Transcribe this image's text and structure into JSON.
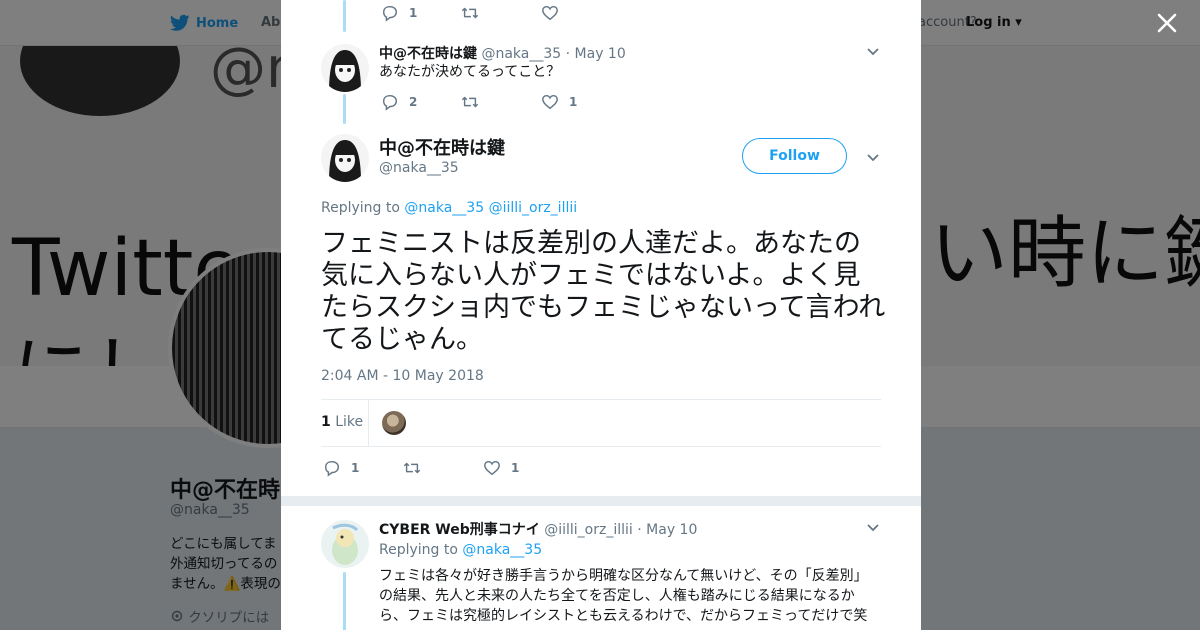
{
  "background": {
    "nav_home": "Home",
    "nav_about": "Abo",
    "account_prompt": "account?",
    "login": "Log in",
    "banner_text_left": "Twitterに",
    "banner_text_right": "い時に鍵",
    "banner_text_bottom": "にし",
    "banner_handle_fragment": "@n",
    "profile_name": "中@不在時は",
    "profile_handle": "@naka__35",
    "bio_line1": "どこにも属してま",
    "bio_line2": "外通知切ってるの",
    "bio_line3": "ません。⚠️表現の",
    "location": "クソリプには"
  },
  "modal": {
    "top_tweet_actions": {
      "reply_count": "1",
      "retweet_count": "",
      "like_count": ""
    },
    "tweet1": {
      "name": "中@不在時は鍵",
      "handle": "@naka__35",
      "separator": "·",
      "date": "May 10",
      "text": "あなたが決めてるってこと？",
      "reply_count": "2",
      "retweet_count": "",
      "like_count": "1"
    },
    "main_tweet": {
      "name": "中@不在時は鍵",
      "handle": "@naka__35",
      "follow_label": "Follow",
      "replying_label": "Replying to",
      "replying_to_1": "@naka__35",
      "replying_to_2": "@iilli_orz_illii",
      "text": "フェミニストは反差別の人達だよ。あなたの気に入らない人がフェミではないよ。よく見たらスクショ内でもフェミじゃないって言われてるじゃん。",
      "timestamp": "2:04 AM - 10 May 2018",
      "likes_number": "1",
      "likes_label": "Like",
      "reply_count": "1",
      "retweet_count": "",
      "like_count": "1"
    },
    "reply_tweet": {
      "name": "CYBER Web刑事コナイ",
      "handle": "@iilli_orz_illii",
      "separator": "·",
      "date": "May 10",
      "replying_label": "Replying to",
      "replying_to": "@naka__35",
      "text": "フェミは各々が好き勝手言うから明確な区分なんて無いけど、その「反差別」の結果、先人と未来の人たち全てを否定し、人権も踏みにじる結果になるから、フェミは究極的レイシストとも云えるわけで、だからフェミってだけで笑"
    }
  },
  "colors": {
    "accent": "#1da1f2",
    "thread_line": "#a9dcf7",
    "muted_text": "#657786"
  },
  "icons": [
    "twitter-bird-icon",
    "close-icon",
    "reply-icon",
    "retweet-icon",
    "heart-icon",
    "chevron-down-icon",
    "location-pin-icon"
  ]
}
